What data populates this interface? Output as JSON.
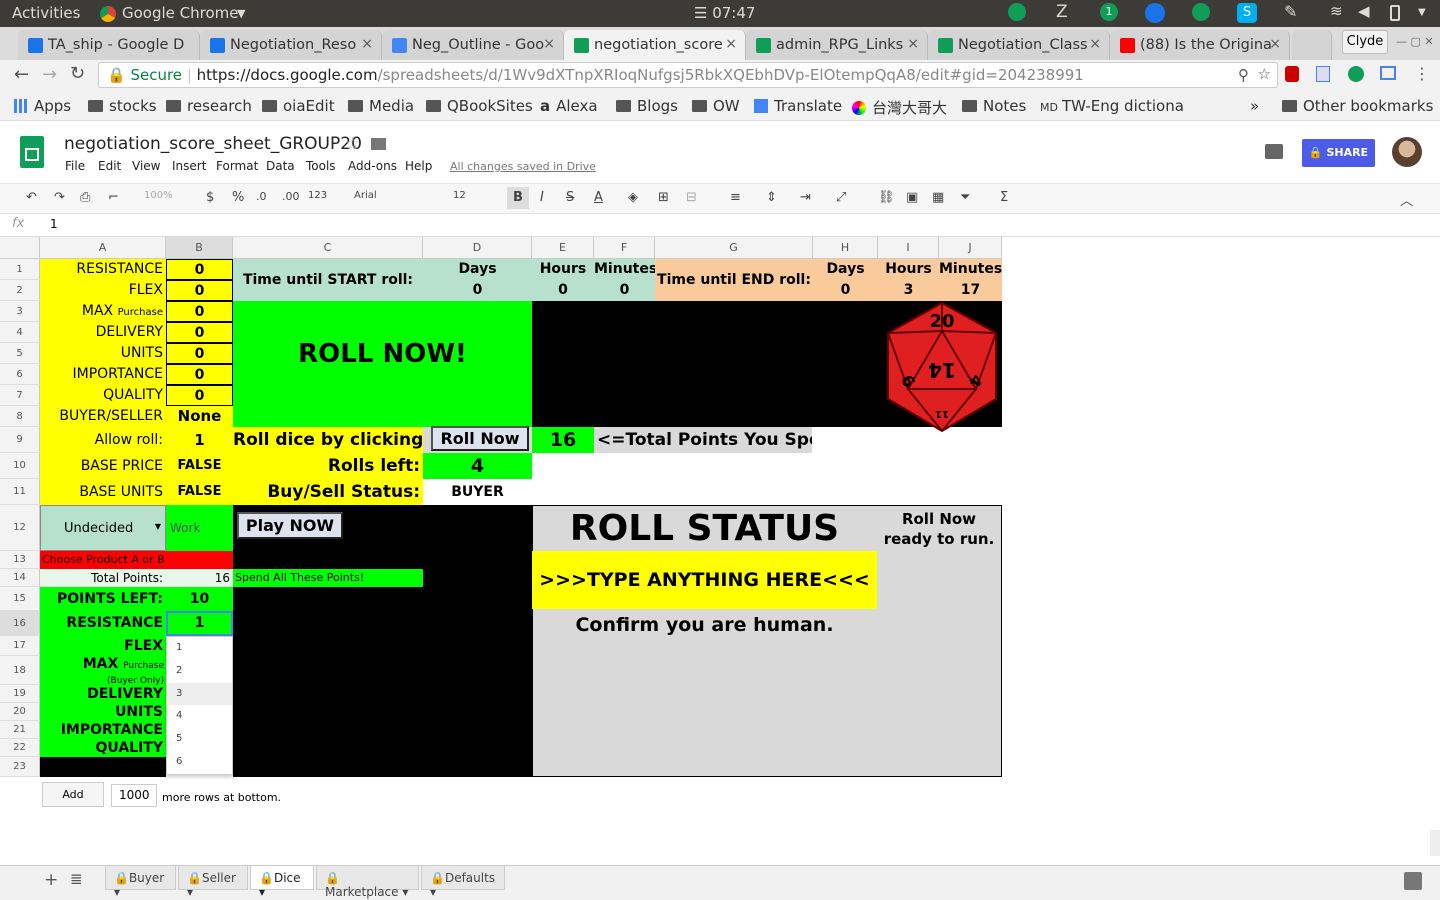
{
  "system": {
    "activities": "Activities",
    "app": "Google Chrome",
    "clock": "07:47",
    "badge": "1"
  },
  "tabs": [
    {
      "label": "TA_ship - Google D",
      "color": "#1a73e8"
    },
    {
      "label": "Negotiation_Reso",
      "color": "#1a73e8"
    },
    {
      "label": "Neg_Outline - Goo",
      "color": "#4285f4"
    },
    {
      "label": "negotiation_score",
      "color": "#0f9d58"
    },
    {
      "label": "admin_RPG_Links",
      "color": "#0f9d58"
    },
    {
      "label": "Negotiation_Class",
      "color": "#0f9d58"
    },
    {
      "label": "(88) Is the Origina",
      "color": "#ff0000"
    }
  ],
  "profile_name": "Clyde",
  "address": {
    "secure": "Secure",
    "url_host": "https://docs.google.com",
    "url_path": "/spreadsheets/d/1Wv9dXTnpXRIoqNufgsj5RbkXQEbhDVp-ElOtempQqA8/edit#gid=204238991"
  },
  "bookmarks": [
    "Apps",
    "stocks",
    "research",
    "oiaEdit",
    "Media",
    "QBookSites",
    "Alexa",
    "Blogs",
    "OW",
    "Translate",
    "台灣大哥大",
    "Notes",
    "TW-Eng dictiona",
    "»",
    "Other bookmarks"
  ],
  "sheet": {
    "title": "negotiation_score_sheet_GROUP20",
    "menus": [
      "File",
      "Edit",
      "View",
      "Insert",
      "Format",
      "Data",
      "Tools",
      "Add-ons",
      "Help"
    ],
    "saved": "All changes saved in Drive",
    "share": "SHARE",
    "toolbar": {
      "zoom": "100%",
      "currency": "$",
      "percent": "%",
      "dec0": ".0",
      "dec00": ".00",
      "fmt": "123",
      "font": "Arial",
      "size": "12",
      "bold": "B",
      "italic": "I",
      "strike": "S",
      "underline": "A"
    },
    "formula_label": "fx",
    "formula_value": "1"
  },
  "columns": [
    "A",
    "B",
    "C",
    "D",
    "E",
    "F",
    "G",
    "H",
    "I",
    "J"
  ],
  "rows": [
    "1",
    "2",
    "3",
    "4",
    "5",
    "6",
    "7",
    "8",
    "9",
    "10",
    "11",
    "12",
    "13",
    "14",
    "15",
    "16",
    "17",
    "18",
    "19",
    "20",
    "21",
    "22",
    "23"
  ],
  "params": {
    "labels": [
      "RESISTANCE",
      "FLEX",
      "MAX",
      "DELIVERY",
      "UNITS",
      "IMPORTANCE",
      "QUALITY",
      "BUYER/SELLER",
      "Allow roll:",
      "BASE PRICE",
      "BASE UNITS"
    ],
    "max_small": "Purchase",
    "values": [
      "0",
      "0",
      "0",
      "0",
      "0",
      "0",
      "0",
      "None",
      "1",
      "FALSE",
      "FALSE"
    ]
  },
  "timer": {
    "start_label": "Time until START roll:",
    "end_label": "Time until END roll:",
    "days": "Days",
    "hours": "Hours",
    "minutes": "Minutes",
    "start_vals": [
      "0",
      "0",
      "0"
    ],
    "end_vals": [
      "0",
      "3",
      "17"
    ]
  },
  "roll": {
    "roll_now": "ROLL NOW!",
    "roll_dice_label": "Roll dice by clicking:",
    "roll_button": "Roll Now",
    "total_points": "16",
    "total_label": "<=Total Points You Spend",
    "rolls_left_label": "Rolls left:",
    "rolls_left": "4",
    "status_label": "Buy/Sell Status:",
    "status": "BUYER",
    "die_top": "20",
    "die_center": "14",
    "die_left": "9",
    "die_right": "4",
    "die_bottom": "11"
  },
  "product": {
    "select": "Undecided",
    "work": "Work",
    "play": "Play NOW",
    "choose": "Choose Product A or B"
  },
  "points": {
    "total_label": "Total Points:",
    "total": "16",
    "spend": "Spend All These Points!",
    "left_label": "POINTS LEFT:",
    "left": "10"
  },
  "alloc": {
    "labels": [
      "RESISTANCE",
      "FLEX",
      "MAX",
      "DELIVERY",
      "UNITS",
      "IMPORTANCE",
      "QUALITY"
    ],
    "max_small1": "Purchase",
    "max_small2": "(Buyer Only)",
    "resistance_value": "1"
  },
  "status_panel": {
    "title": "ROLL STATUS",
    "ready": "Roll Now ready to run.",
    "type_here": ">>>TYPE ANYTHING HERE<<<",
    "confirm": "Confirm you are human."
  },
  "dropdown": [
    "1",
    "2",
    "3",
    "4",
    "5",
    "6"
  ],
  "footer": {
    "add": "Add",
    "rows": "1000",
    "more": "more rows at bottom."
  },
  "sheet_tabs": [
    "Buyer",
    "Seller",
    "Dice",
    "Marketplace",
    "Defaults"
  ],
  "colors": {
    "yellow": "#ffff00",
    "green": "#00ff00",
    "die": "#e02020",
    "share": "#4c5be8"
  }
}
